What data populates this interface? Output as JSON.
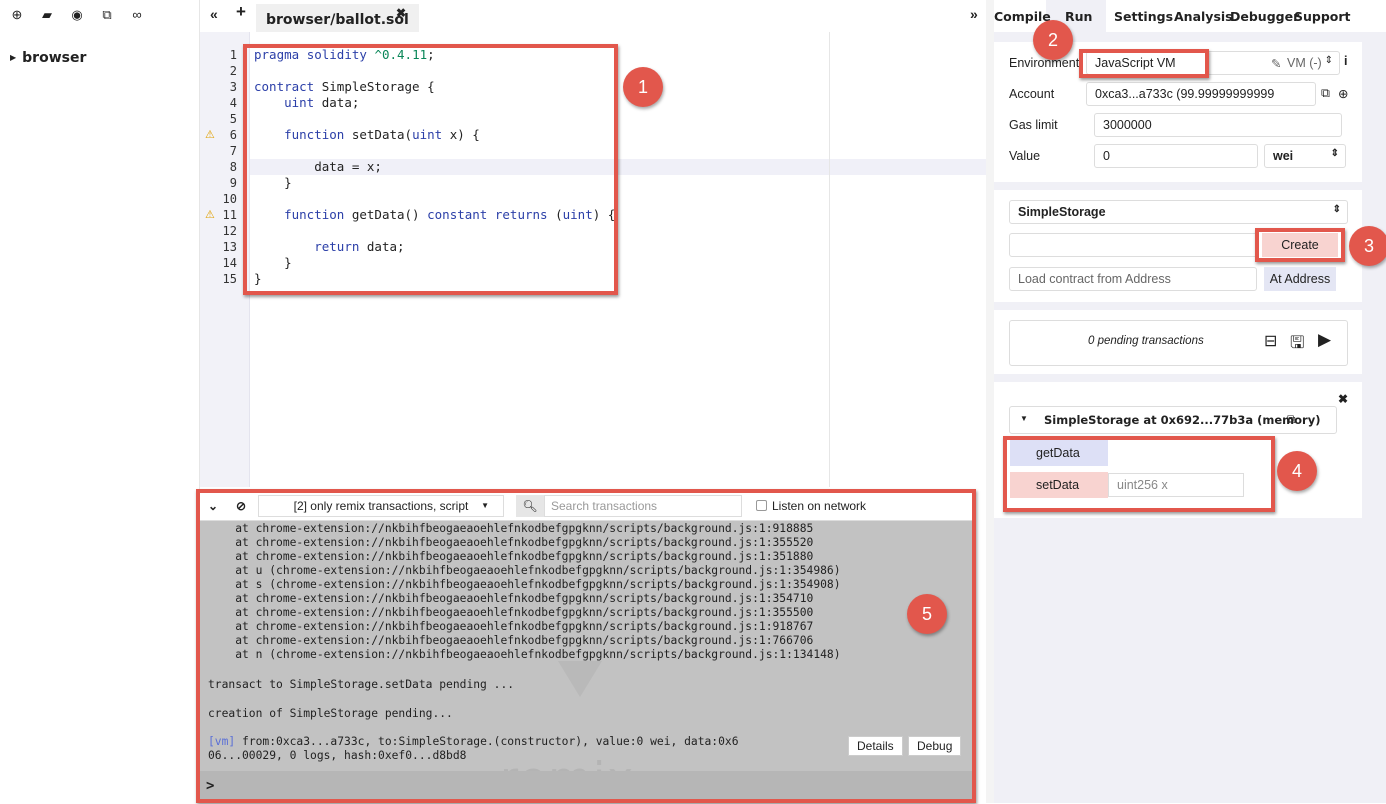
{
  "left_panel": {
    "icons": [
      "plus-circle-icon",
      "folder-open-icon",
      "github-icon",
      "copy-icon",
      "link-icon"
    ],
    "tree_root": "browser"
  },
  "tabbar": {
    "collapse_left": "«",
    "new_tab": "+",
    "file_tab": "browser/ballot.sol",
    "close": "✖",
    "collapse_right": "»"
  },
  "editor": {
    "lines": [
      {
        "n": "1",
        "text": "pragma solidity ^0.4.11;"
      },
      {
        "n": "2",
        "text": ""
      },
      {
        "n": "3",
        "text": "contract SimpleStorage {"
      },
      {
        "n": "4",
        "text": "    uint data;"
      },
      {
        "n": "5",
        "text": ""
      },
      {
        "n": "6",
        "text": "    function setData(uint x) {"
      },
      {
        "n": "7",
        "text": ""
      },
      {
        "n": "8",
        "text": "        data = x;"
      },
      {
        "n": "9",
        "text": "    }"
      },
      {
        "n": "10",
        "text": ""
      },
      {
        "n": "11",
        "text": "    function getData() constant returns (uint) {"
      },
      {
        "n": "12",
        "text": ""
      },
      {
        "n": "13",
        "text": "        return data;"
      },
      {
        "n": "14",
        "text": "    }"
      },
      {
        "n": "15",
        "text": "}"
      }
    ],
    "warning_lines": [
      "6",
      "11"
    ],
    "fold_lines": [
      "3",
      "6",
      "11"
    ]
  },
  "annotations": [
    "1",
    "2",
    "3",
    "4",
    "5"
  ],
  "terminal": {
    "filter": "[2] only remix transactions, script",
    "search_placeholder": "Search transactions",
    "listen_label": "Listen on network",
    "log_lines": [
      "    at chrome-extension://nkbihfbeogaeaoehlefnkodbefgpgknn/scripts/background.js:1:918885",
      "    at chrome-extension://nkbihfbeogaeaoehlefnkodbefgpgknn/scripts/background.js:1:355520",
      "    at chrome-extension://nkbihfbeogaeaoehlefnkodbefgpgknn/scripts/background.js:1:351880",
      "    at u (chrome-extension://nkbihfbeogaeaoehlefnkodbefgpgknn/scripts/background.js:1:354986)",
      "    at s (chrome-extension://nkbihfbeogaeaoehlefnkodbefgpgknn/scripts/background.js:1:354908)",
      "    at chrome-extension://nkbihfbeogaeaoehlefnkodbefgpgknn/scripts/background.js:1:354710",
      "    at chrome-extension://nkbihfbeogaeaoehlefnkodbefgpgknn/scripts/background.js:1:355500",
      "    at chrome-extension://nkbihfbeogaeaoehlefnkodbefgpgknn/scripts/background.js:1:918767",
      "    at chrome-extension://nkbihfbeogaeaoehlefnkodbefgpgknn/scripts/background.js:1:766706",
      "    at n (chrome-extension://nkbihfbeogaeaoehlefnkodbefgpgknn/scripts/background.js:1:134148)"
    ],
    "pending_1": "transact to SimpleStorage.setData pending ...",
    "pending_2": "creation of SimpleStorage pending...",
    "vm_tag": "[vm]",
    "tx_line_1": " from:0xca3...a733c, to:SimpleStorage.(constructor), value:0 wei, data:0x6",
    "tx_line_2": "06...00029, 0 logs, hash:0xef0...d8bd8",
    "details_btn": "Details",
    "debug_btn": "Debug",
    "watermark": "remix",
    "prompt": ">"
  },
  "right_panel": {
    "tabs": [
      "Compile",
      "Run",
      "Settings",
      "Analysis",
      "Debugger",
      "Support"
    ],
    "active_tab": "Run",
    "environment_label": "Environment",
    "environment_value": "JavaScript VM",
    "vm_indicator": "VM (-)",
    "account_label": "Account",
    "account_value": "0xca3...a733c (99.99999999999",
    "gas_label": "Gas limit",
    "gas_value": "3000000",
    "value_label": "Value",
    "value_value": "0",
    "unit_value": "wei",
    "contract_select": "SimpleStorage",
    "create_btn": "Create",
    "load_placeholder": "Load contract from Address",
    "at_address_btn": "At Address",
    "pending_tx": "0 pending transactions",
    "instance_title": "SimpleStorage at 0x692...77b3a (memory)",
    "getdata_btn": "getData",
    "setdata_btn": "setData",
    "setdata_placeholder": "uint256 x"
  }
}
